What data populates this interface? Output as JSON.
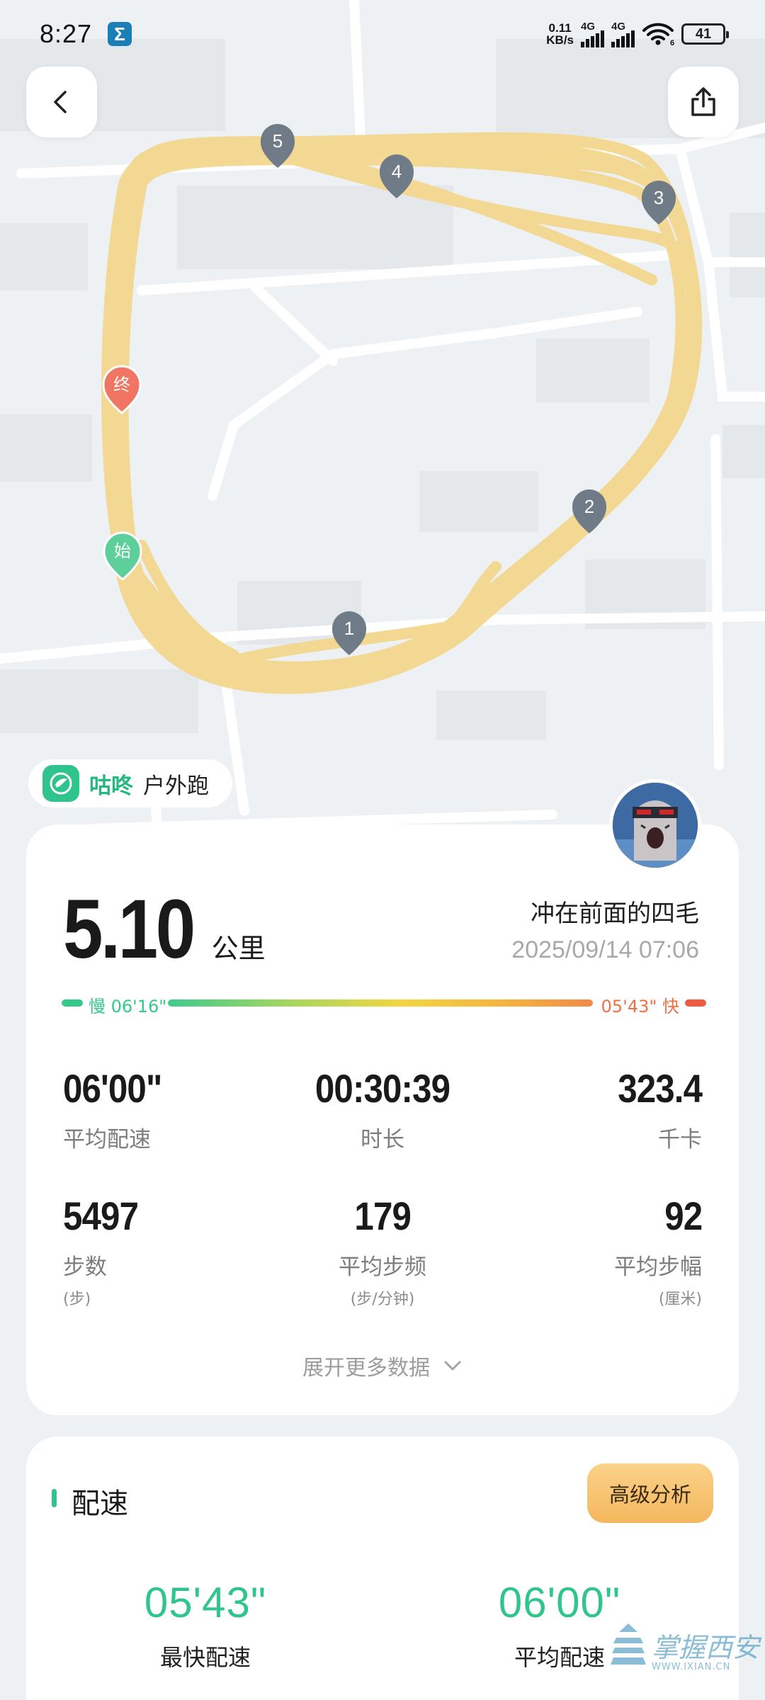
{
  "status_bar": {
    "time": "8:27",
    "app_icon": "Σ",
    "net_speed_value": "0.11",
    "net_speed_unit": "KB/s",
    "signal1_tag": "4G",
    "signal2_tag": "4G",
    "wifi_badge": "6",
    "battery": "41"
  },
  "map": {
    "route_color": "#f4d78e",
    "km_markers": [
      "1",
      "2",
      "3",
      "4",
      "5"
    ],
    "start_label": "始",
    "end_label": "终",
    "start_color": "#5ccf9b",
    "end_color": "#f07563",
    "marker_color": "#6f7b86"
  },
  "app_tag": {
    "name": "咕咚",
    "type": "户外跑"
  },
  "summary": {
    "distance": "5.10",
    "distance_unit": "公里",
    "user_name": "冲在前面的四毛",
    "date": "2025/09/14 07:06",
    "pace_slow": "慢 06'16\"",
    "pace_fast": "05'43\" 快",
    "stats": [
      {
        "value": "06'00\"",
        "label": "平均配速",
        "unit": ""
      },
      {
        "value": "00:30:39",
        "label": "时长",
        "unit": ""
      },
      {
        "value": "323.4",
        "label": "千卡",
        "unit": ""
      },
      {
        "value": "5497",
        "label": "步数",
        "unit": "(步)"
      },
      {
        "value": "179",
        "label": "平均步频",
        "unit": "(步/分钟)"
      },
      {
        "value": "92",
        "label": "平均步幅",
        "unit": "(厘米)"
      }
    ],
    "expand_label": "展开更多数据"
  },
  "pace_section": {
    "title": "配速",
    "analysis_button": "高级分析",
    "fastest_value": "05'43\"",
    "fastest_label": "最快配速",
    "average_value": "06'00\"",
    "average_label": "平均配速"
  },
  "watermark": {
    "text": "掌握西安",
    "url": "WWW.IXIAN.CN"
  }
}
